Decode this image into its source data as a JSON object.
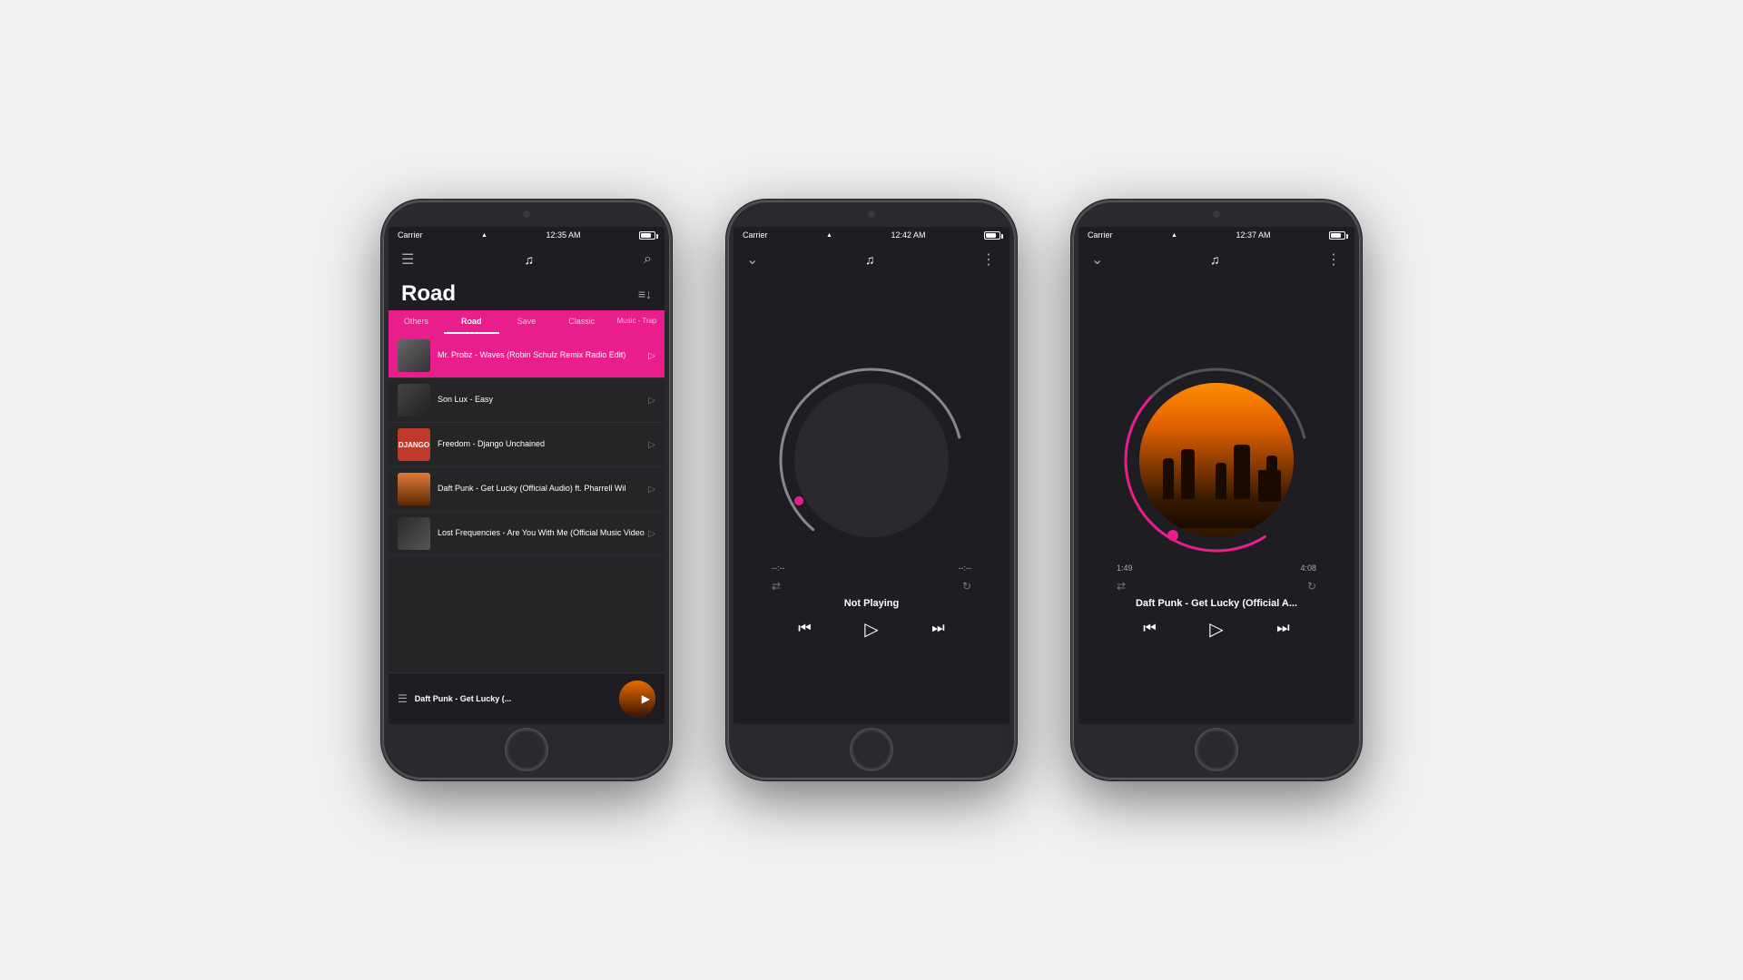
{
  "background": "#f0f0f0",
  "phones": [
    {
      "id": "phone1",
      "type": "playlist",
      "status": {
        "carrier": "Carrier",
        "time": "12:35 AM",
        "battery": 70
      },
      "header": {
        "title": "♫",
        "menu_icon": "☰",
        "search_icon": "🔍"
      },
      "playlist_title": "Road",
      "tabs": [
        "Others",
        "Road",
        "Save",
        "Classic",
        "Music - Trap"
      ],
      "active_tab": "Road",
      "songs": [
        {
          "title": "Mr. Probz - Waves (Robin Schulz Remix Radio Edit)",
          "thumb_class": "thumb-waves",
          "active": true
        },
        {
          "title": "Son Lux - Easy",
          "thumb_class": "thumb-sonlux",
          "active": false
        },
        {
          "title": "Freedom - Django Unchained",
          "thumb_class": "thumb-django",
          "active": false
        },
        {
          "title": "Daft Punk - Get Lucky (Official Audio) ft. Pharrell Wil",
          "thumb_class": "thumb-daftpunk",
          "active": false
        },
        {
          "title": "Lost Frequencies - Are You With Me (Official Music Video",
          "thumb_class": "thumb-lostfreq",
          "active": false
        }
      ],
      "mini_player": {
        "title": "Daft Punk - Get Lucky (..."
      }
    },
    {
      "id": "phone2",
      "type": "player_empty",
      "status": {
        "carrier": "Carrier",
        "time": "12:42 AM"
      },
      "progress_start": "--:--",
      "progress_end": "--:--",
      "progress_pct": 0,
      "track_label": "Not Playing",
      "has_album_art": false
    },
    {
      "id": "phone3",
      "type": "player_playing",
      "status": {
        "carrier": "Carrier",
        "time": "12:37 AM"
      },
      "progress_start": "1:49",
      "progress_end": "4:08",
      "progress_pct": 44,
      "track_label": "Daft Punk - Get Lucky (Official A...",
      "has_album_art": true
    }
  ]
}
